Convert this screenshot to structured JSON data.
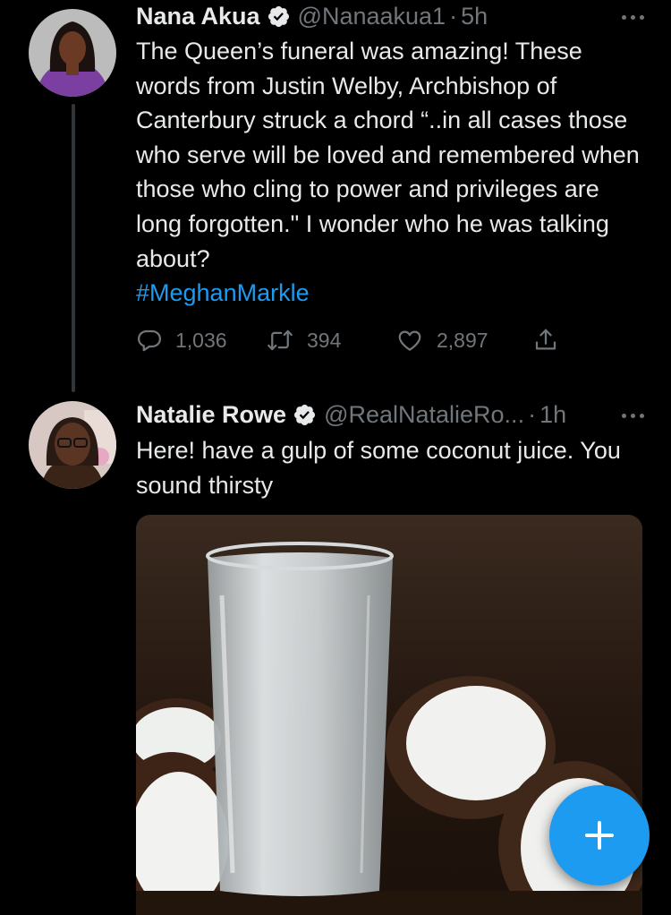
{
  "tweet1": {
    "name": "Nana Akua",
    "handle": "@Nanaakua1",
    "dot": "·",
    "time": "5h",
    "text": "The Queen’s funeral was amazing! These words from Justin Welby, Archbishop of Canterbury struck a chord “..in all cases those who serve will be loved and remembered when those who cling to power and privileges are long forgotten.\" I wonder who he was talking about?",
    "hashtag": "#MeghanMarkle",
    "replies": "1,036",
    "retweets": "394",
    "likes": "2,897"
  },
  "tweet2": {
    "name": "Natalie Rowe",
    "handle": "@RealNatalieRo...",
    "dot": "·",
    "time": "1h",
    "text": "Here! have a gulp of some coconut juice. You sound thirsty"
  },
  "icons": {
    "verified": "verified-badge-icon",
    "more": "more-dots-icon",
    "reply": "reply-icon",
    "retweet": "retweet-icon",
    "like": "heart-icon",
    "share": "share-icon",
    "compose": "plus-icon"
  },
  "colors": {
    "background": "#000000",
    "text": "#e7e9ea",
    "secondary": "#71767b",
    "accent": "#1d9bf0"
  }
}
